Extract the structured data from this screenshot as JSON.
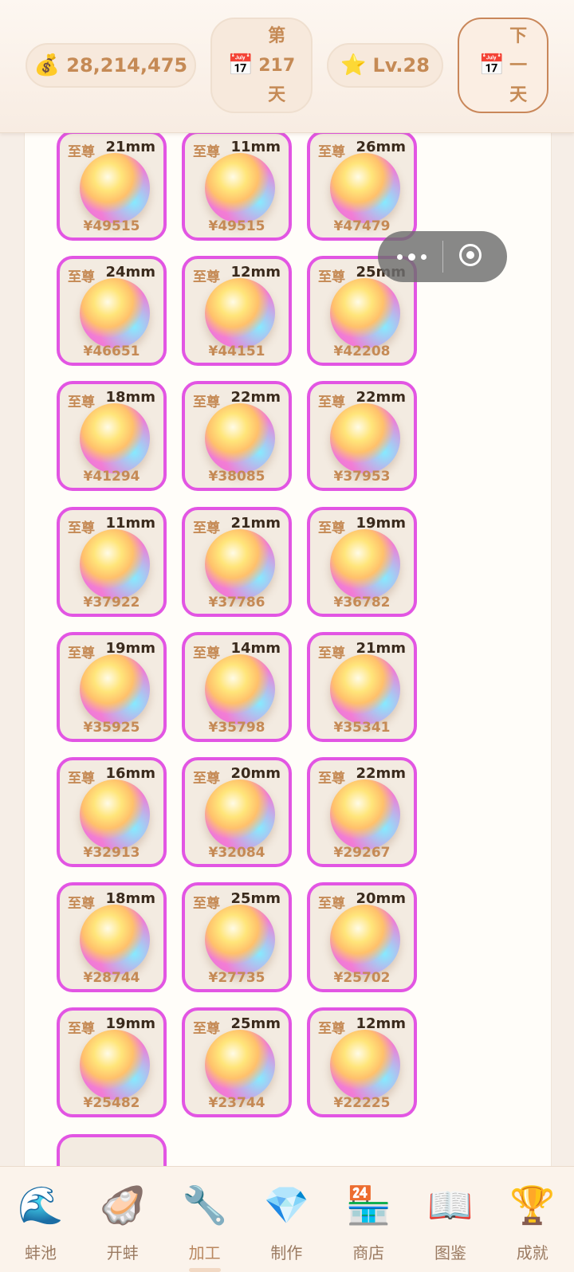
{
  "header": {
    "money": "28,214,475",
    "money_icon": "money-bag-icon",
    "day_chars": [
      "第",
      "217",
      "天"
    ],
    "calendar_icon": "calendar-icon",
    "level": "Lv.28",
    "level_icon": "star-icon",
    "next_day_chars": [
      "下",
      "一",
      "天"
    ]
  },
  "pearls": [
    {
      "grade": "至尊",
      "size": "21mm",
      "price": "¥49515"
    },
    {
      "grade": "至尊",
      "size": "11mm",
      "price": "¥49515"
    },
    {
      "grade": "至尊",
      "size": "26mm",
      "price": "¥47479"
    },
    {
      "grade": "至尊",
      "size": "24mm",
      "price": "¥46651"
    },
    {
      "grade": "至尊",
      "size": "12mm",
      "price": "¥44151"
    },
    {
      "grade": "至尊",
      "size": "25mm",
      "price": "¥42208"
    },
    {
      "grade": "至尊",
      "size": "18mm",
      "price": "¥41294"
    },
    {
      "grade": "至尊",
      "size": "22mm",
      "price": "¥38085"
    },
    {
      "grade": "至尊",
      "size": "22mm",
      "price": "¥37953"
    },
    {
      "grade": "至尊",
      "size": "11mm",
      "price": "¥37922"
    },
    {
      "grade": "至尊",
      "size": "21mm",
      "price": "¥37786"
    },
    {
      "grade": "至尊",
      "size": "19mm",
      "price": "¥36782"
    },
    {
      "grade": "至尊",
      "size": "19mm",
      "price": "¥35925"
    },
    {
      "grade": "至尊",
      "size": "14mm",
      "price": "¥35798"
    },
    {
      "grade": "至尊",
      "size": "21mm",
      "price": "¥35341"
    },
    {
      "grade": "至尊",
      "size": "16mm",
      "price": "¥32913"
    },
    {
      "grade": "至尊",
      "size": "20mm",
      "price": "¥32084"
    },
    {
      "grade": "至尊",
      "size": "22mm",
      "price": "¥29267"
    },
    {
      "grade": "至尊",
      "size": "18mm",
      "price": "¥28744"
    },
    {
      "grade": "至尊",
      "size": "25mm",
      "price": "¥27735"
    },
    {
      "grade": "至尊",
      "size": "20mm",
      "price": "¥25702"
    },
    {
      "grade": "至尊",
      "size": "19mm",
      "price": "¥25482"
    },
    {
      "grade": "至尊",
      "size": "25mm",
      "price": "¥23744"
    },
    {
      "grade": "至尊",
      "size": "12mm",
      "price": "¥22225"
    }
  ],
  "nav": {
    "active": "加工",
    "items": [
      {
        "label": "蚌池",
        "icon": "wave-icon",
        "glyph": "🌊"
      },
      {
        "label": "开蚌",
        "icon": "oyster-icon",
        "glyph": "🦪"
      },
      {
        "label": "加工",
        "icon": "wrench-icon",
        "glyph": "🔧"
      },
      {
        "label": "制作",
        "icon": "gem-icon",
        "glyph": "💎"
      },
      {
        "label": "商店",
        "icon": "store-icon",
        "glyph": "🏪"
      },
      {
        "label": "图鉴",
        "icon": "book-icon",
        "glyph": "📖"
      },
      {
        "label": "成就",
        "icon": "trophy-icon",
        "glyph": "🏆"
      }
    ]
  }
}
